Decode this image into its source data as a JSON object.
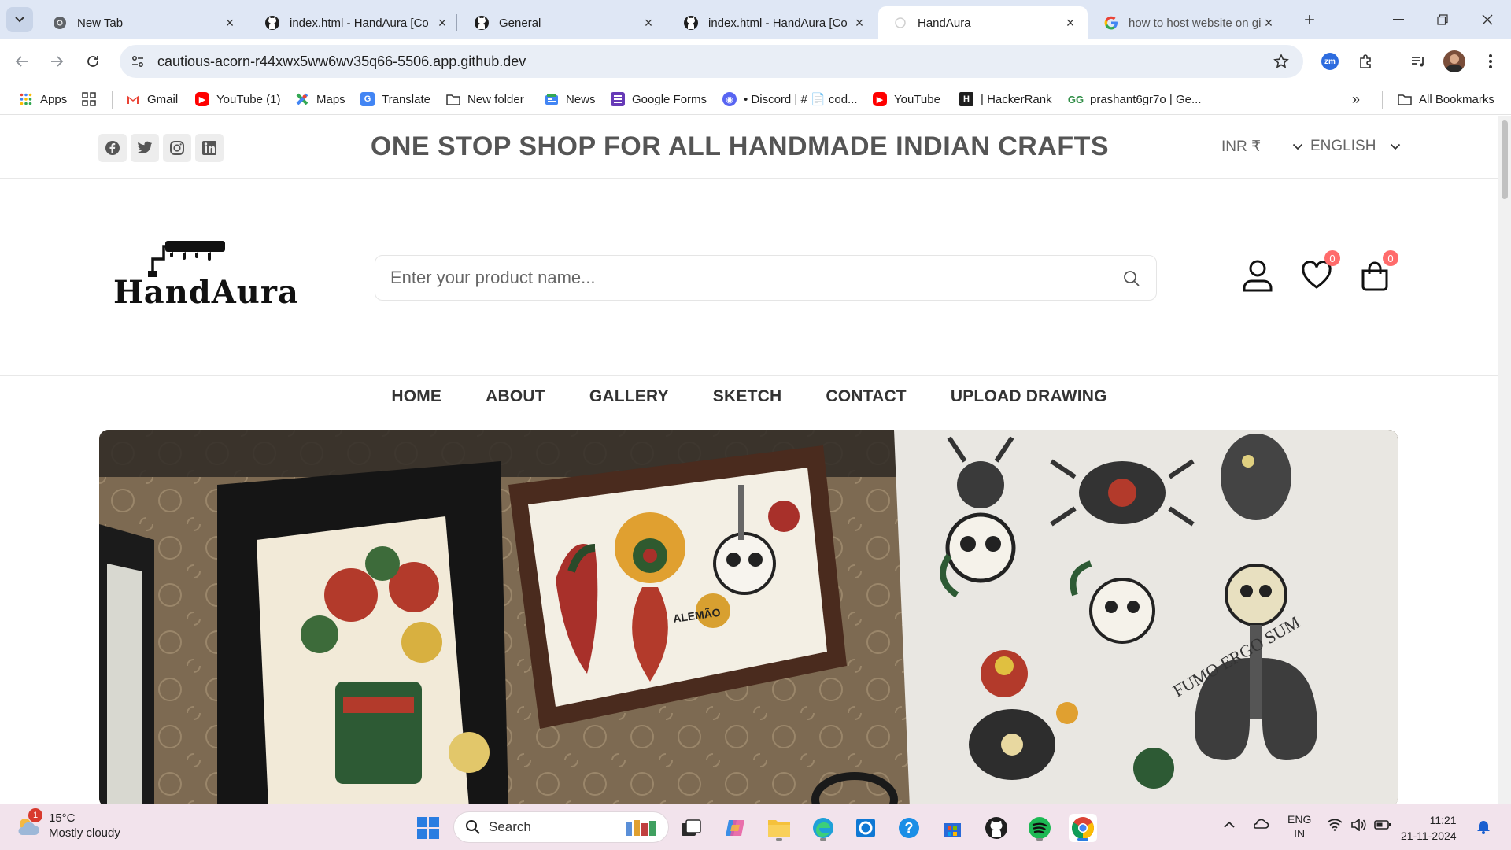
{
  "browser": {
    "tabs": [
      {
        "title": "New Tab",
        "icon": "chrome-icon"
      },
      {
        "title": "index.html - HandAura [Co",
        "icon": "github-icon"
      },
      {
        "title": "General",
        "icon": "github-icon"
      },
      {
        "title": "index.html - HandAura [Co",
        "icon": "github-icon"
      },
      {
        "title": "HandAura",
        "icon": "page-icon",
        "active": true
      },
      {
        "title": "how to host website on git",
        "icon": "google-icon"
      }
    ],
    "url": "cautious-acorn-r44xwx5ww6wv35q66-5506.app.github.dev",
    "bookmarks": [
      {
        "label": "Apps"
      },
      {
        "label": "Gmail"
      },
      {
        "label": "YouTube (1)"
      },
      {
        "label": "Maps"
      },
      {
        "label": "Translate"
      },
      {
        "label": "New folder"
      },
      {
        "label": "News"
      },
      {
        "label": "Google Forms"
      },
      {
        "label": "• Discord | # 📄 cod..."
      },
      {
        "label": "YouTube"
      },
      {
        "label": "| HackerRank"
      },
      {
        "label": "prashant6gr7o | Ge..."
      }
    ],
    "all_bookmarks": "All Bookmarks",
    "zoom_badge": "zm"
  },
  "site": {
    "tagline": "ONE STOP SHOP FOR ALL HANDMADE INDIAN CRAFTS",
    "currency": "INR ₹",
    "language": "ENGLISH",
    "logo_text": "HandAura",
    "search_placeholder": "Enter your product name...",
    "wishlist_count": "0",
    "cart_count": "0",
    "nav": [
      "HOME",
      "ABOUT",
      "GALLERY",
      "SKETCH",
      "CONTACT",
      "UPLOAD DRAWING"
    ],
    "hero_caption_art": "ALEMÃO",
    "hero_caption_art2": "FUMO ERGO SUM"
  },
  "taskbar": {
    "weather_badge": "1",
    "temperature": "15°C",
    "condition": "Mostly cloudy",
    "search_label": "Search",
    "lang_line1": "ENG",
    "lang_line2": "IN",
    "time": "11:21",
    "date": "21-11-2024"
  },
  "colors": {
    "tabbar_bg": "#dfe7f5",
    "accent_badge": "#ff6b6b",
    "taskbar_bg": "#f2e3ec"
  }
}
